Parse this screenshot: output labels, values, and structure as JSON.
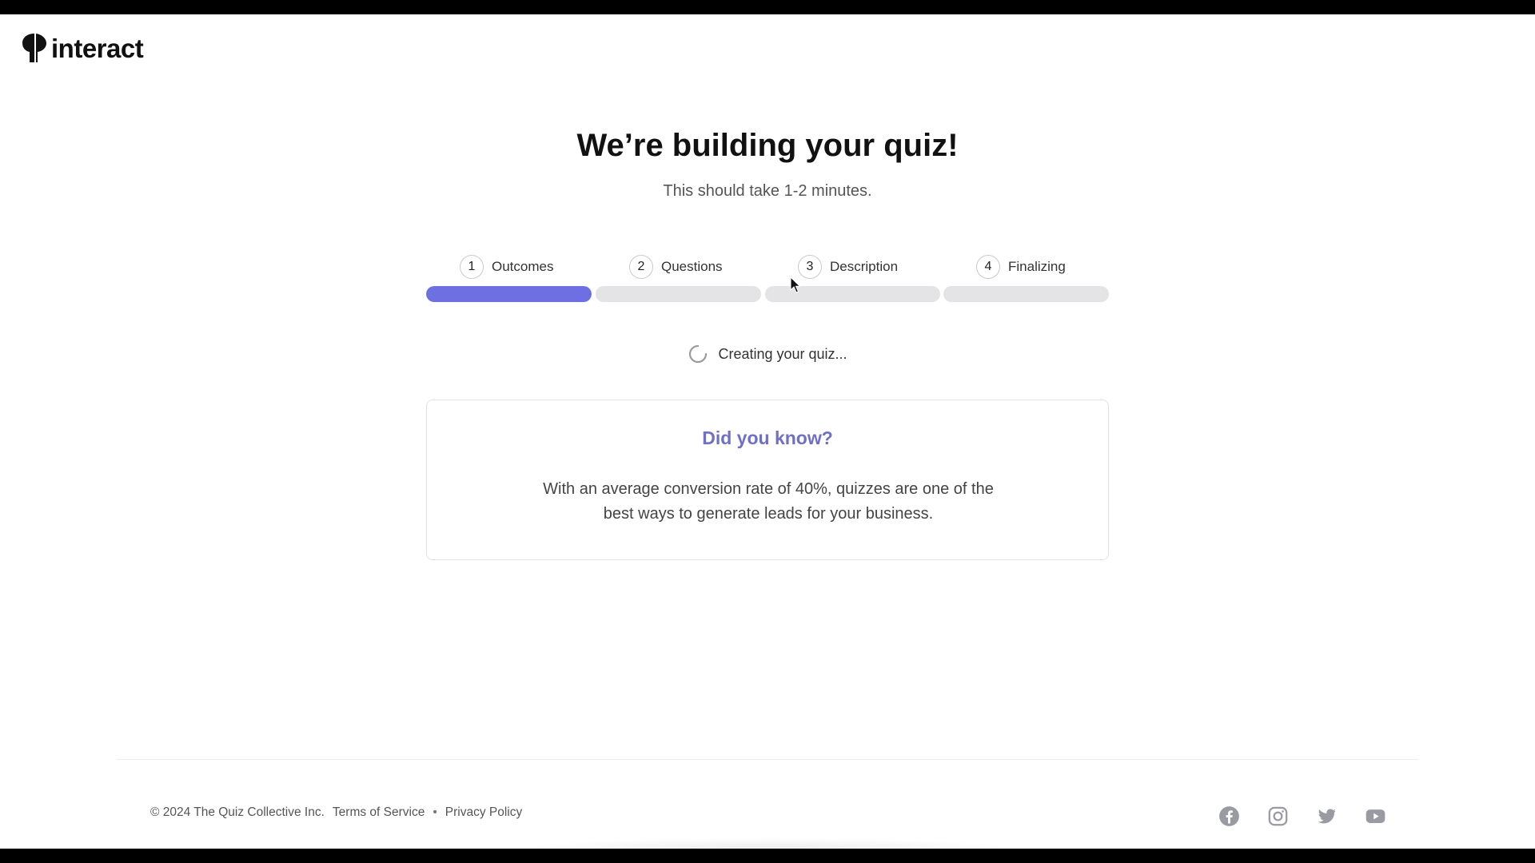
{
  "header": {
    "logo_text": "interact"
  },
  "main": {
    "title": "We’re building your quiz!",
    "subtitle": "This should take 1-2 minutes.",
    "steps": [
      {
        "number": "1",
        "label": "Outcomes",
        "progress": 1.0
      },
      {
        "number": "2",
        "label": "Questions",
        "progress": 0.0
      },
      {
        "number": "3",
        "label": "Description",
        "progress": 0.0
      },
      {
        "number": "4",
        "label": "Finalizing",
        "progress": 0.0
      }
    ],
    "status_text": "Creating your quiz...",
    "tip": {
      "title": "Did you know?",
      "body": "With an average conversion rate of 40%, quizzes are one of the best ways to generate leads for your business."
    }
  },
  "footer": {
    "copyright": "© 2024 The Quiz Collective Inc.",
    "terms": "Terms of Service",
    "separator": "•",
    "privacy": "Privacy Policy",
    "social_icons": [
      "facebook-icon",
      "instagram-icon",
      "twitter-icon",
      "youtube-icon"
    ]
  },
  "colors": {
    "accent": "#6e6fe3",
    "tip_title": "#6f6fc8",
    "track": "#e4e4e7"
  }
}
